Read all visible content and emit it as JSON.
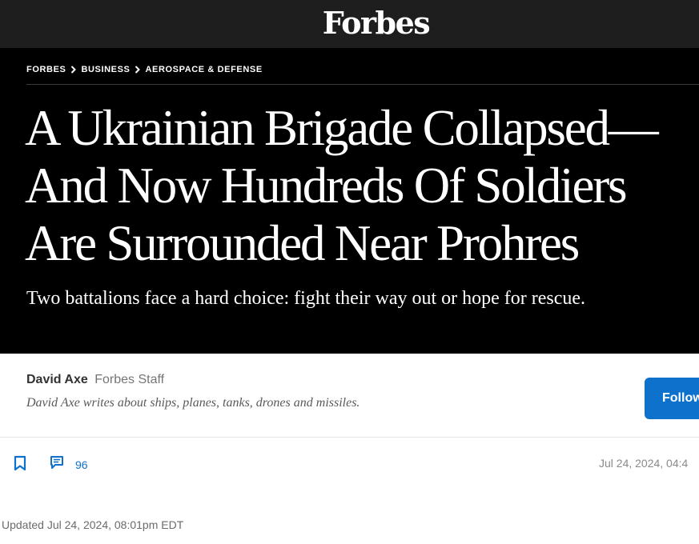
{
  "header": {
    "logo": "Forbes"
  },
  "breadcrumb": {
    "items": [
      "FORBES",
      "BUSINESS",
      "AEROSPACE & DEFENSE"
    ],
    "separator_icon": "chevron-right-icon"
  },
  "article": {
    "headline": "A Ukrainian Brigade Collapsed—And Now Hundreds Of Soldiers Are Surrounded Near Prohres",
    "subhead": "Two battalions face a hard choice: fight their way out or hope for rescue."
  },
  "author": {
    "name": "David Axe",
    "role": "Forbes Staff",
    "bio": "David Axe writes about ships, planes, tanks, drones and missiles.",
    "follow_label": "Follow"
  },
  "toolbar": {
    "bookmark_icon": "bookmark-icon",
    "comment_icon": "comment-icon",
    "comment_count": "96",
    "published": "Jul 24, 2024, 04:4"
  },
  "updated": "Updated Jul 24, 2024, 08:01pm EDT",
  "colors": {
    "accent": "#0e72cc",
    "hero_bg": "#000000",
    "topbar_bg": "#1e1e1e"
  }
}
